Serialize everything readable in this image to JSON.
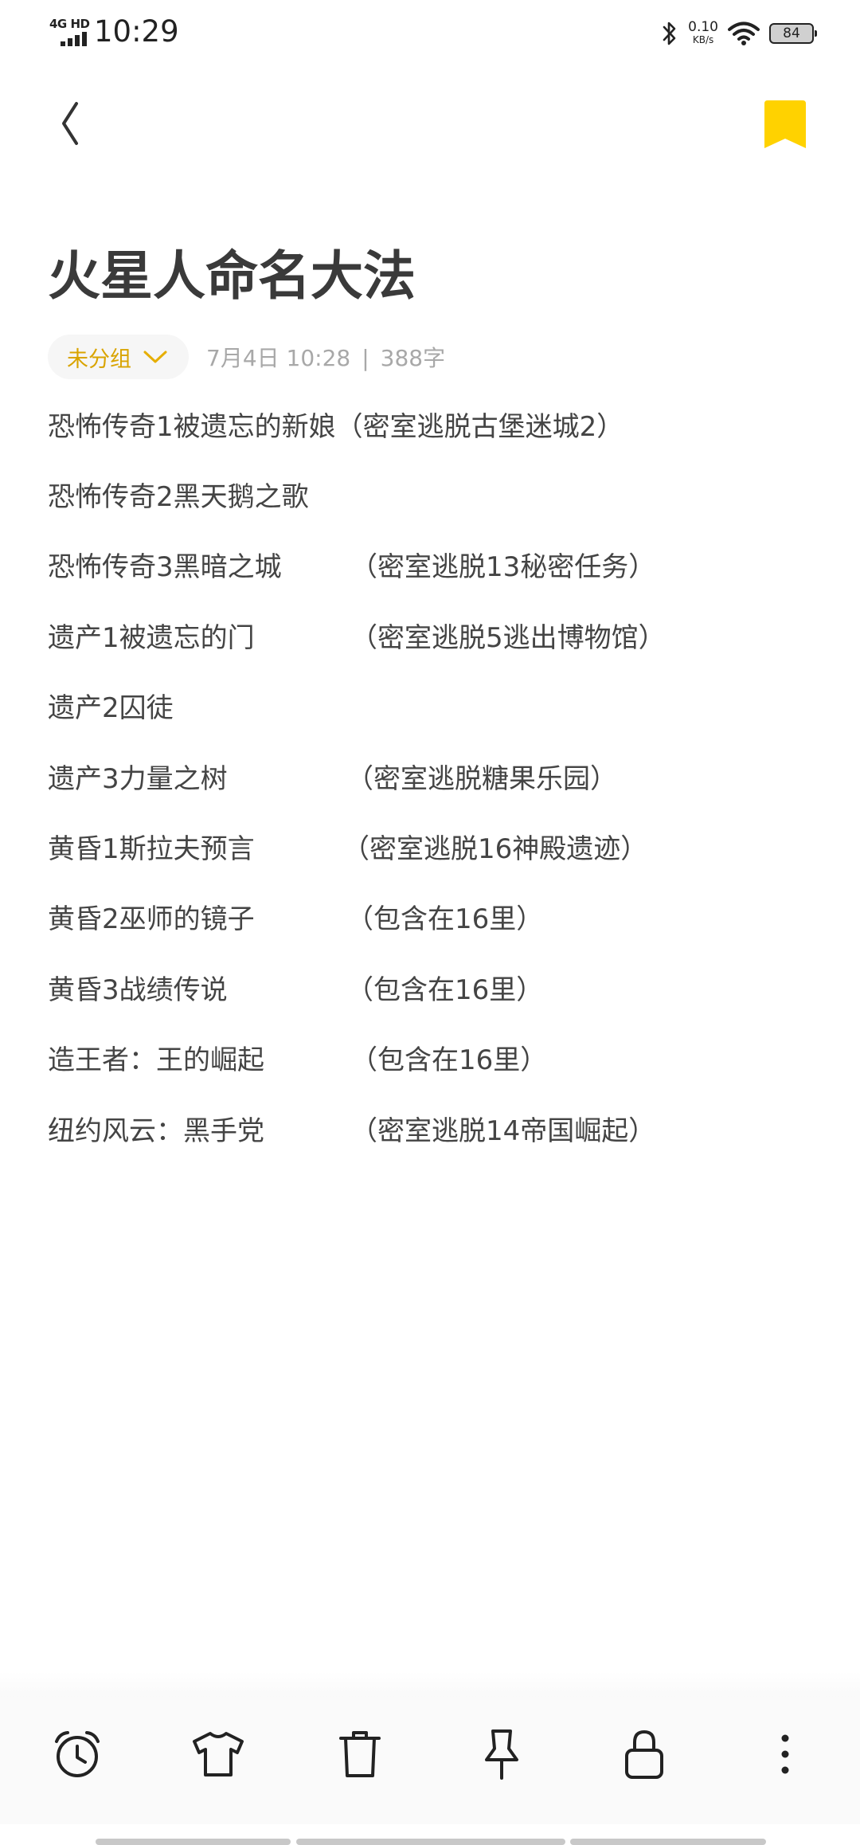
{
  "status_bar": {
    "network": "4G HD",
    "time": "10:29",
    "speed_value": "0.10",
    "speed_unit": "KB/s",
    "battery": "84"
  },
  "note": {
    "title": "火星人命名大法",
    "group": "未分组",
    "date": "7月4日 10:28",
    "separator": "|",
    "word_count": "388字"
  },
  "lines": [
    {
      "game": "恐怖传奇1被遗忘的新娘",
      "note": "（密室逃脱古堡迷城2）"
    },
    {
      "game": "恐怖传奇2黑天鹅之歌",
      "note": ""
    },
    {
      "game": "恐怖传奇3黑暗之城",
      "note": "（密室逃脱13秘密任务）"
    },
    {
      "game": "遗产1被遗忘的门",
      "note": "（密室逃脱5逃出博物馆）"
    },
    {
      "game": "遗产2囚徒",
      "note": ""
    },
    {
      "game": "遗产3力量之树",
      "note": "（密室逃脱糖果乐园）"
    },
    {
      "game": "黄昏1斯拉夫预言",
      "note": "（密室逃脱16神殿遗迹）"
    },
    {
      "game": "黄昏2巫师的镜子",
      "note": "（包含在16里）"
    },
    {
      "game": "黄昏3战绩传说",
      "note": "（包含在16里）"
    },
    {
      "game": "造王者：王的崛起",
      "note": "（包含在16里）"
    },
    {
      "game": "纽约风云：黑手党",
      "note": "（密室逃脱14帝国崛起）"
    }
  ],
  "colors": {
    "accent": "#FFD200",
    "group_text": "#D9A400",
    "meta_text": "#A8A8A8",
    "body_text": "#444444"
  },
  "icons": {
    "back": "back-arrow-icon",
    "bookmark": "bookmark-icon",
    "alarm": "alarm-clock-icon",
    "theme": "tshirt-icon",
    "delete": "trash-icon",
    "pin": "pin-icon",
    "lock": "lock-icon",
    "more": "more-vertical-icon"
  }
}
